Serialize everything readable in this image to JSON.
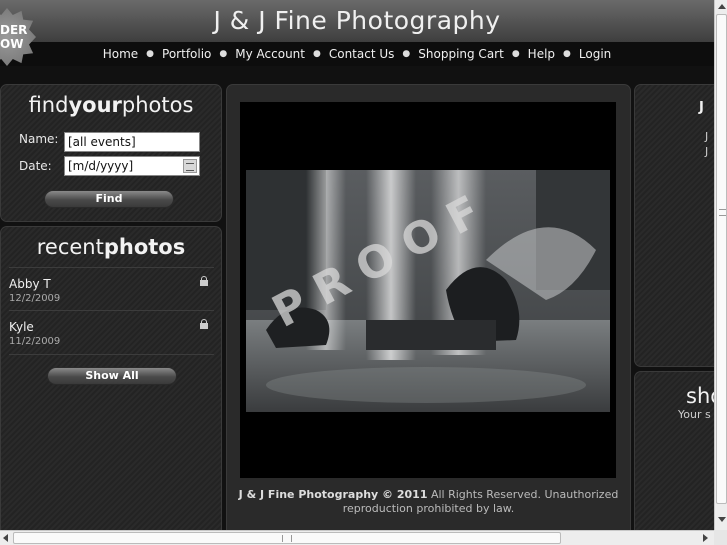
{
  "header": {
    "site_title": "J & J Fine Photography",
    "nav": [
      "Home",
      "Portfolio",
      "My Account",
      "Contact Us",
      "Shopping Cart",
      "Help",
      "Login"
    ],
    "nav_separator": "●"
  },
  "badge": {
    "line1": "DER",
    "line2": "OW"
  },
  "find_panel": {
    "title_light": "find",
    "title_bold": "your",
    "title_light2": "photos",
    "name_label": "Name:",
    "name_value": "[all events]",
    "date_label": "Date:",
    "date_value": "[m/d/yyyy]",
    "find_button": "Find"
  },
  "recent_panel": {
    "title_light": "recent",
    "title_bold": "photos",
    "items": [
      {
        "name": "Abby T",
        "date": "12/2/2009"
      },
      {
        "name": "Kyle",
        "date": "11/2/2009"
      }
    ],
    "show_all_button": "Show All"
  },
  "photo": {
    "watermark": "PROOF"
  },
  "footer": {
    "brand": "J & J Fine Photography © 2011",
    "line1_rest": " All Rights Reserved. Unauthorized",
    "line2": "reproduction prohibited by law."
  },
  "right_column": {
    "top_letter": "J",
    "line_a": "J",
    "line_b": "J",
    "bottom_title": "sho",
    "bottom_sub": "Your s"
  },
  "colors": {
    "background": "#111111",
    "panel": "#2a2a2a",
    "header_top": "#6a6a6a",
    "navbar": "#0d0d0d"
  }
}
